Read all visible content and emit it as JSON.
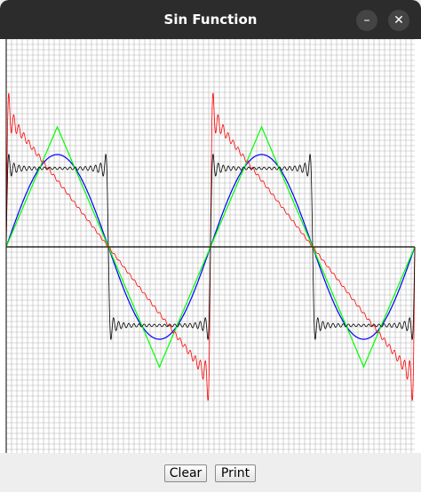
{
  "window": {
    "title": "Sin Function",
    "minimize_symbol": "–",
    "close_symbol": "✕"
  },
  "buttons": {
    "clear_label": "Clear",
    "print_label": "Print"
  },
  "plot": {
    "colors": {
      "grid": "#b4b4b4",
      "axis": "#000000",
      "sine": "#0000ff",
      "triangle": "#00ff00",
      "sawtooth": "#ff0000",
      "square": "#000000"
    },
    "periods_shown": 2
  }
}
